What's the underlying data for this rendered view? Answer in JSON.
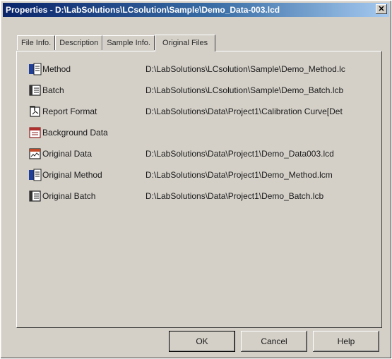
{
  "window": {
    "title": "Properties - D:\\LabSolutions\\LCsolution\\Sample\\Demo_Data-003.lcd",
    "close_glyph": "✕"
  },
  "tabs": [
    {
      "label": "File Info."
    },
    {
      "label": "Description"
    },
    {
      "label": "Sample Info."
    },
    {
      "label": "Original Files",
      "active": true
    }
  ],
  "files": [
    {
      "label": "Method",
      "path": "D:\\LabSolutions\\LCsolution\\Sample\\Demo_Method.lc",
      "icon": "method-file-icon"
    },
    {
      "label": "Batch",
      "path": "D:\\LabSolutions\\LCsolution\\Sample\\Demo_Batch.lcb",
      "icon": "batch-file-icon"
    },
    {
      "label": "Report Format",
      "path": "D:\\LabSolutions\\Data\\Project1\\Calibration Curve[Det",
      "icon": "report-format-icon"
    },
    {
      "label": "Background Data",
      "path": "",
      "icon": "background-data-icon"
    },
    {
      "label": "Original Data",
      "path": "D:\\LabSolutions\\Data\\Project1\\Demo_Data003.lcd",
      "icon": "data-file-icon"
    },
    {
      "label": "Original Method",
      "path": "D:\\LabSolutions\\Data\\Project1\\Demo_Method.lcm",
      "icon": "method-file-icon"
    },
    {
      "label": "Original Batch",
      "path": "D:\\LabSolutions\\Data\\Project1\\Demo_Batch.lcb",
      "icon": "batch-file-icon"
    }
  ],
  "buttons": {
    "ok": "OK",
    "cancel": "Cancel",
    "help": "Help"
  }
}
